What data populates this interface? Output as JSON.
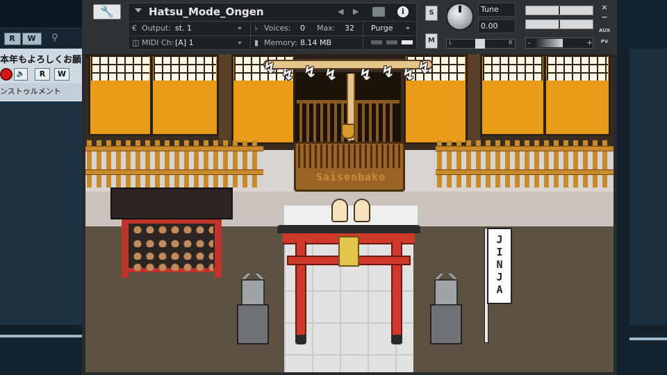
{
  "host": {
    "toolbar_buttons": [
      "R",
      "W"
    ],
    "track": {
      "name": "本年もよろしくお願",
      "rec_label": "",
      "r_label": "R",
      "w_label": "W",
      "instrument_label": "ンストゥルメント"
    }
  },
  "kontakt": {
    "instrument_name": "Hatsu_Mode_Ongen",
    "output_label": "Output:",
    "output_value": "st. 1",
    "voices_label": "Voices:",
    "voices_value": "0",
    "max_label": "Max:",
    "max_value": "32",
    "purge_label": "Purge",
    "midi_label": "MIDI Ch:",
    "midi_value": "[A] 1",
    "memory_label": "Memory:",
    "memory_value": "8.14 MB",
    "solo_label": "S",
    "mute_label": "M",
    "tune_label": "Tune",
    "tune_value": "0.00",
    "pan_left": "L",
    "pan_right": "R",
    "vol_minus": "-",
    "vol_plus": "+",
    "side_buttons": [
      "×",
      "−",
      "AUX",
      "PV"
    ],
    "colors": {
      "panel": "#2d3236",
      "display": "#1d2124",
      "text": "#e6e8ea"
    }
  },
  "scene": {
    "box_label": "Saisenbako",
    "banner_text": "JINJA",
    "colors": {
      "shoji": "#e89c1a",
      "torii": "#d03a2a",
      "ground": "#5d5142",
      "path": "#e1e1e1"
    }
  }
}
